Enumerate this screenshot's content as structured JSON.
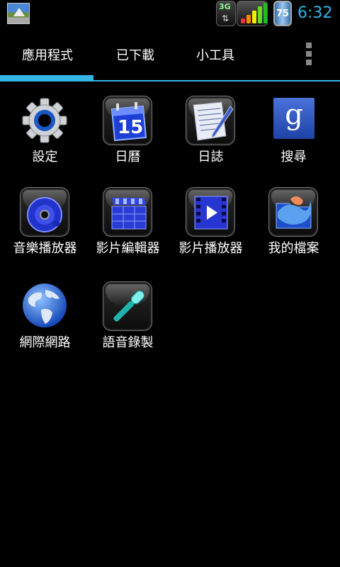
{
  "status_bar": {
    "network_type": "3G",
    "battery_level": "75",
    "time": "6:32"
  },
  "tabs": {
    "items": [
      "應用程式",
      "已下載",
      "小工具"
    ],
    "selected_index": 0
  },
  "apps": [
    {
      "label": "設定",
      "icon": "gear-icon"
    },
    {
      "label": "日曆",
      "icon": "calendar-icon",
      "icon_text": "15"
    },
    {
      "label": "日誌",
      "icon": "notepad-icon"
    },
    {
      "label": "搜尋",
      "icon": "google-search-icon",
      "icon_text": "g"
    },
    {
      "label": "音樂播放器",
      "icon": "music-disc-icon"
    },
    {
      "label": "影片編輯器",
      "icon": "clapperboard-icon"
    },
    {
      "label": "影片播放器",
      "icon": "film-play-icon"
    },
    {
      "label": "我的檔案",
      "icon": "folder-icon"
    },
    {
      "label": "網際網路",
      "icon": "globe-icon"
    },
    {
      "label": "語音錄製",
      "icon": "microphone-icon"
    }
  ],
  "colors": {
    "accent": "#33b5e5",
    "background": "#000000"
  }
}
